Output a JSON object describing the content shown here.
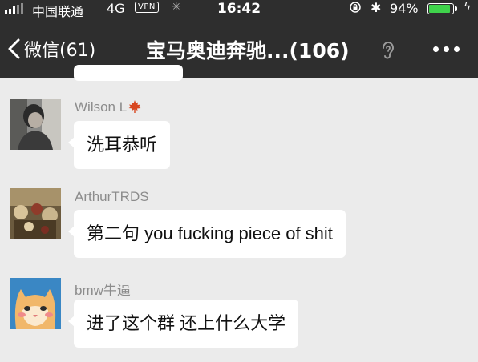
{
  "status_bar": {
    "carrier": "中国联通",
    "network": "4G",
    "vpn": "VPN",
    "time": "16:42",
    "battery_pct": "94%",
    "battery_level": 0.94,
    "battery_color": "#3fd34b"
  },
  "nav": {
    "back_label": "微信(61)",
    "title": "宝马奥迪奔驰...(106)"
  },
  "messages": [
    {
      "sender": "Wilson L",
      "text": "洗耳恭听"
    },
    {
      "sender": "ArthurTRDS",
      "text": "第二句 you fucking piece of shit"
    },
    {
      "sender": "bmw牛逼",
      "text": "进了这个群 还上什么大学"
    }
  ],
  "colors": {
    "header_bg": "#2e2e2e",
    "chat_bg": "#ebebeb",
    "bubble_bg": "#ffffff",
    "sender_name": "#8c8c8c"
  }
}
